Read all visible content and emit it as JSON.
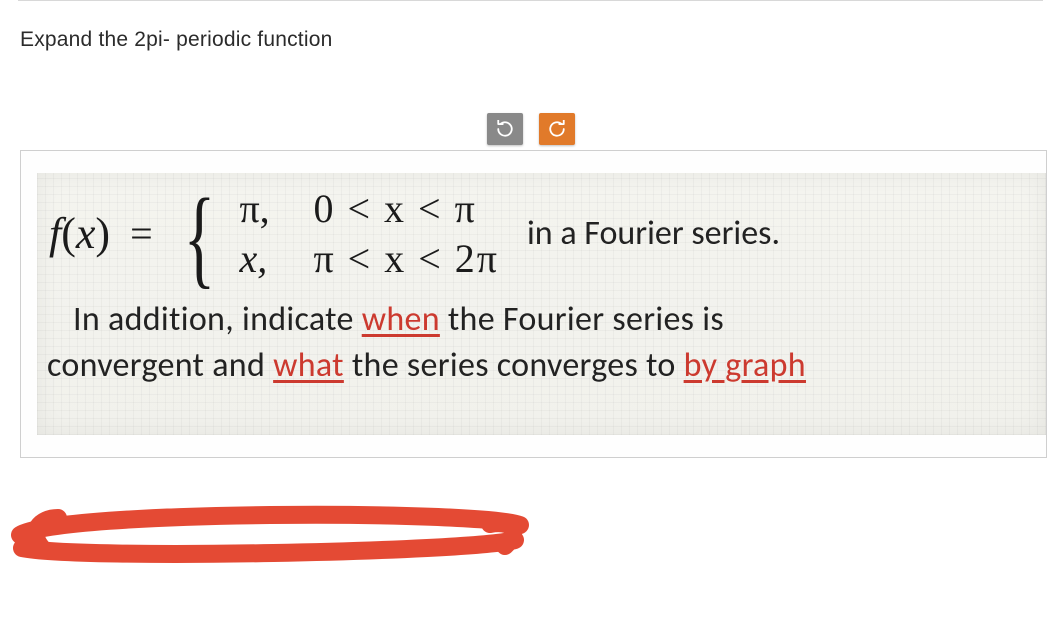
{
  "prompt": "Expand the 2pi- periodic function",
  "formula": {
    "lhs_f": "f",
    "lhs_open": "(",
    "lhs_var": "x",
    "lhs_close": ")",
    "eq": "=",
    "case1_val": "π,",
    "case1_cond": "0 < x < π",
    "case2_val": "x,",
    "case2_cond": "π < x < 2π",
    "trailing": " in a Fourier series."
  },
  "line2_pre": "In addition, indicate ",
  "line2_when": "when",
  "line2_post": " the Fourier series is",
  "line3_pre": "convergent and ",
  "line3_what": "what",
  "line3_mid": " the series converges to ",
  "line3_bygraph": "by graph"
}
